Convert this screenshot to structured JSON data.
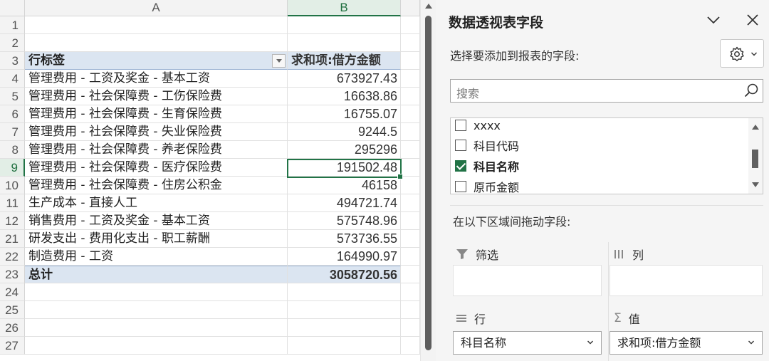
{
  "sheet": {
    "columns": [
      "A",
      "B"
    ],
    "header_row": {
      "row": "3",
      "label": "行标签",
      "value_header": "求和项:借方金额"
    },
    "rows": [
      {
        "row": "4",
        "label": "管理费用 - 工资及奖金 - 基本工资",
        "value": "673927.43"
      },
      {
        "row": "5",
        "label": "管理费用 - 社会保障费 - 工伤保险费",
        "value": "16638.86"
      },
      {
        "row": "6",
        "label": "管理费用 - 社会保障费 - 生育保险费",
        "value": "16755.07"
      },
      {
        "row": "7",
        "label": "管理费用 - 社会保障费 - 失业保险费",
        "value": "9244.5"
      },
      {
        "row": "8",
        "label": "管理费用 - 社会保障费 - 养老保险费",
        "value": "295296"
      },
      {
        "row": "9",
        "label": "管理费用 - 社会保障费 - 医疗保险费",
        "value": "191502.48"
      },
      {
        "row": "10",
        "label": "管理费用 - 社会保障费 - 住房公积金",
        "value": "46158"
      },
      {
        "row": "11",
        "label": "生产成本 - 直接人工",
        "value": "494721.74"
      },
      {
        "row": "12",
        "label": "销售费用 - 工资及奖金 - 基本工资",
        "value": "575748.96"
      },
      {
        "row": "21",
        "label": "研发支出 - 费用化支出 - 职工薪酬",
        "value": "573736.55"
      },
      {
        "row": "22",
        "label": "制造费用 - 工资",
        "value": "164990.97"
      }
    ],
    "total_row": {
      "row": "23",
      "label": "总计",
      "value": "3058720.56"
    },
    "empty_rows_top": [
      "1",
      "2"
    ],
    "empty_rows_bottom": [
      "24",
      "25",
      "26",
      "27"
    ]
  },
  "pane": {
    "title": "数据透视表字段",
    "subtitle": "选择要添加到报表的字段:",
    "search_placeholder": "搜索",
    "fields": [
      {
        "label": "xxxx",
        "checked": false
      },
      {
        "label": "科目代码",
        "checked": false
      },
      {
        "label": "科目名称",
        "checked": true
      },
      {
        "label": "原币金额",
        "checked": false
      }
    ],
    "drag_label": "在以下区域间拖动字段:",
    "areas": {
      "filter": "筛选",
      "columns": "列",
      "rows": "行",
      "values": "值"
    },
    "rows_value": "科目名称",
    "values_value": "求和项:借方金额"
  },
  "icons": {
    "close": "close-icon",
    "collapse": "chevron-down-icon",
    "settings": "gear-icon",
    "search": "search-icon",
    "filter": "filter-icon",
    "columns": "columns-icon",
    "rows": "rows-icon",
    "values": "sigma-icon"
  },
  "colors": {
    "accent": "#217346",
    "pivot_header": "#dbe5f1"
  }
}
